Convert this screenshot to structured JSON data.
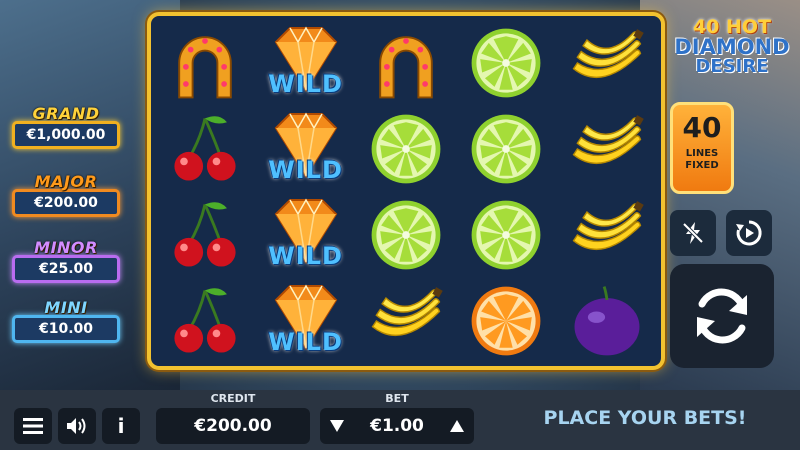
{
  "logo": {
    "line1": "40 HOT",
    "line2": "DIAMOND",
    "line3": "DESIRE"
  },
  "jackpots": [
    {
      "title": "GRAND",
      "amount": "€1,000.00"
    },
    {
      "title": "MAJOR",
      "amount": "€200.00"
    },
    {
      "title": "MINOR",
      "amount": "€25.00"
    },
    {
      "title": "MINI",
      "amount": "€10.00"
    }
  ],
  "lines": {
    "count": "40",
    "label1": "LINES",
    "label2": "FIXED"
  },
  "reels": [
    [
      "horseshoe",
      "cherries",
      "cherries",
      "cherries"
    ],
    [
      "wild",
      "wild",
      "wild",
      "wild"
    ],
    [
      "horseshoe",
      "lime",
      "lime",
      "banana"
    ],
    [
      "lime",
      "lime",
      "lime",
      "orange"
    ],
    [
      "banana",
      "banana",
      "banana",
      "plum"
    ]
  ],
  "wild_text": "WILD",
  "bottom": {
    "credit_label": "CREDIT",
    "credit_value": "€200.00",
    "bet_label": "BET",
    "bet_value": "€1.00",
    "message": "PLACE YOUR BETS!",
    "info_label": "i"
  },
  "colors": {
    "frame": "#f2c230",
    "reel_bg": "#152a4a",
    "message": "#a7d4f0"
  }
}
